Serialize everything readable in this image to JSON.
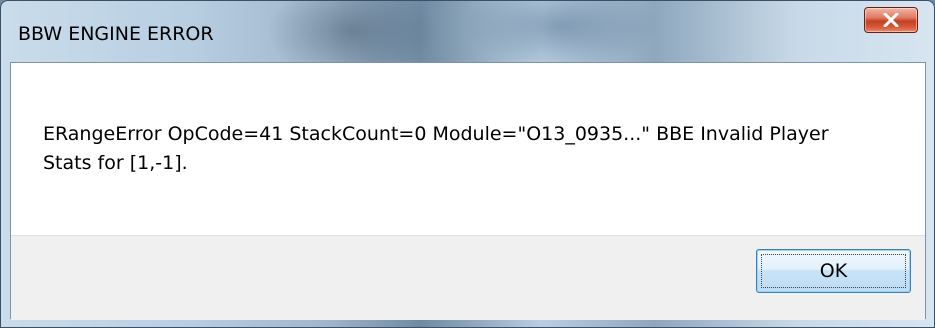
{
  "dialog": {
    "title": "BBW ENGINE ERROR",
    "message": "ERangeError OpCode=41 StackCount=0 Module=\"O13_0935...\" BBE Invalid Player Stats for [1,-1].",
    "ok_label": "OK",
    "close_icon": "close-x-icon"
  },
  "colors": {
    "close_button": "#c24224",
    "ok_button_border": "#3c7fb1",
    "button_area": "#f0f0f0"
  }
}
